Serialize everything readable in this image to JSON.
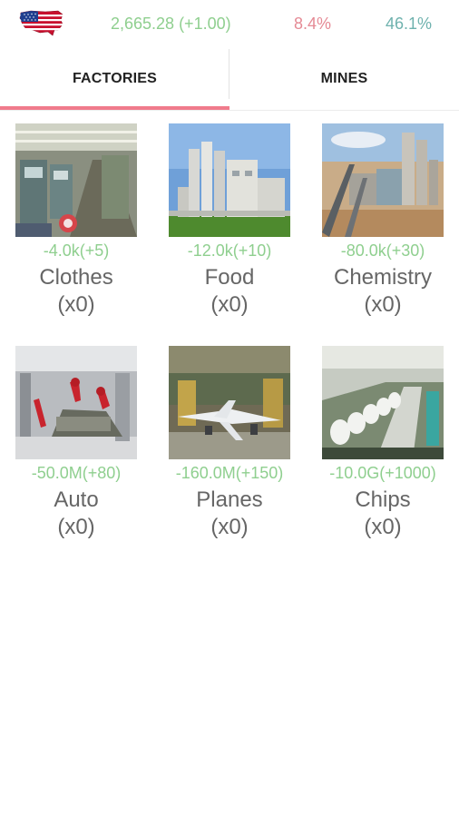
{
  "topbar": {
    "flag_icon": "us-flag-map-icon",
    "money": "2,665.28 (+1.00)",
    "stat_one": "8.4%",
    "stat_two": "46.1%"
  },
  "tabs": [
    {
      "label": "FACTORIES",
      "selected": true
    },
    {
      "label": "MINES",
      "selected": false
    }
  ],
  "colors": {
    "money": "#8fcf8f",
    "stat_one": "#e58a95",
    "stat_two": "#6fb2ae",
    "tab_indicator": "#f07b8c",
    "cost": "#8fcf8f"
  },
  "factories": [
    {
      "cost": "-4.0k(+5)",
      "name": "Clothes",
      "count": "(x0)",
      "image": "clothes-factory-photo"
    },
    {
      "cost": "-12.0k(+10)",
      "name": "Food",
      "count": "(x0)",
      "image": "food-factory-photo"
    },
    {
      "cost": "-80.0k(+30)",
      "name": "Chemistry",
      "count": "(x0)",
      "image": "chemistry-plant-photo"
    },
    {
      "cost": "-50.0M(+80)",
      "name": "Auto",
      "count": "(x0)",
      "image": "auto-factory-photo"
    },
    {
      "cost": "-160.0M(+150)",
      "name": "Planes",
      "count": "(x0)",
      "image": "plane-factory-photo"
    },
    {
      "cost": "-10.0G(+1000)",
      "name": "Chips",
      "count": "(x0)",
      "image": "chip-factory-photo"
    }
  ]
}
